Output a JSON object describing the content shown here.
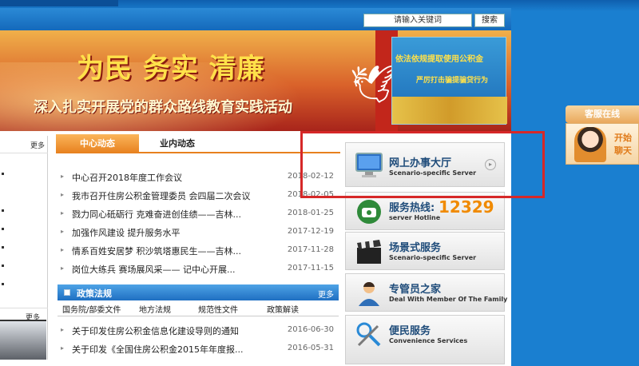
{
  "search": {
    "placeholder": "请输入关键词",
    "button": "搜索"
  },
  "banner": {
    "headline": "为民 务实 清廉",
    "subline": "深入扎实开展党的群众路线教育实践活动",
    "panel_line1": "依法依规提取使用公积金",
    "panel_line2": "严厉打击骗提骗贷行为"
  },
  "left_panel": {
    "more1": "更多",
    "more2": "更多"
  },
  "news": {
    "tab_active": "中心动态",
    "tab_inactive": "业内动态",
    "items": [
      {
        "title": "中心召开2018年度工作会议",
        "date": "2018-02-12"
      },
      {
        "title": "我市召开住房公积金管理委员 会四届二次会议",
        "date": "2018-02-05"
      },
      {
        "title": "戮力同心砥砺行 克难奋进创佳绩——吉林...",
        "date": "2018-01-25"
      },
      {
        "title": "加强作风建设 提升服务水平",
        "date": "2017-12-19"
      },
      {
        "title": "情系百姓安居梦 积沙筑塔惠民生——吉林...",
        "date": "2017-11-28"
      },
      {
        "title": "岗位大练兵 赛场展风采—— 记中心开展...",
        "date": "2017-11-15"
      }
    ]
  },
  "policy": {
    "title": "政策法规",
    "more": "更多",
    "subtabs": [
      "国务院/部委文件",
      "地方法规",
      "规范性文件",
      "政策解读"
    ],
    "items": [
      {
        "title": "关于印发住房公积金信息化建设导则的通知",
        "date": "2016-06-30"
      },
      {
        "title": "关于印发《全国住房公积金2015年年度报...",
        "date": "2016-05-31"
      }
    ]
  },
  "services": [
    {
      "zh": "网上办事大厅",
      "en": "Scenario-specific Server",
      "icon": "monitor-icon"
    },
    {
      "zh": "服务热线:",
      "en": "server Hotline",
      "number": "12329",
      "icon": "phone-icon"
    },
    {
      "zh": "场景式服务",
      "en": "Scenario-specific Server",
      "icon": "clapperboard-icon"
    },
    {
      "zh": "专管员之家",
      "en": "Deal With Member Of The Family",
      "icon": "person-icon"
    },
    {
      "zh": "便民服务",
      "en": "Convenience Services",
      "icon": "tools-icon"
    }
  ],
  "customer_service": {
    "tab": "客服在线",
    "line1": "开始",
    "line2": "聊天"
  },
  "colors": {
    "accent_orange": "#e7801e",
    "nav_blue": "#1f6fc2",
    "highlight_red": "#d62828",
    "hotline_orange": "#f08a00"
  }
}
